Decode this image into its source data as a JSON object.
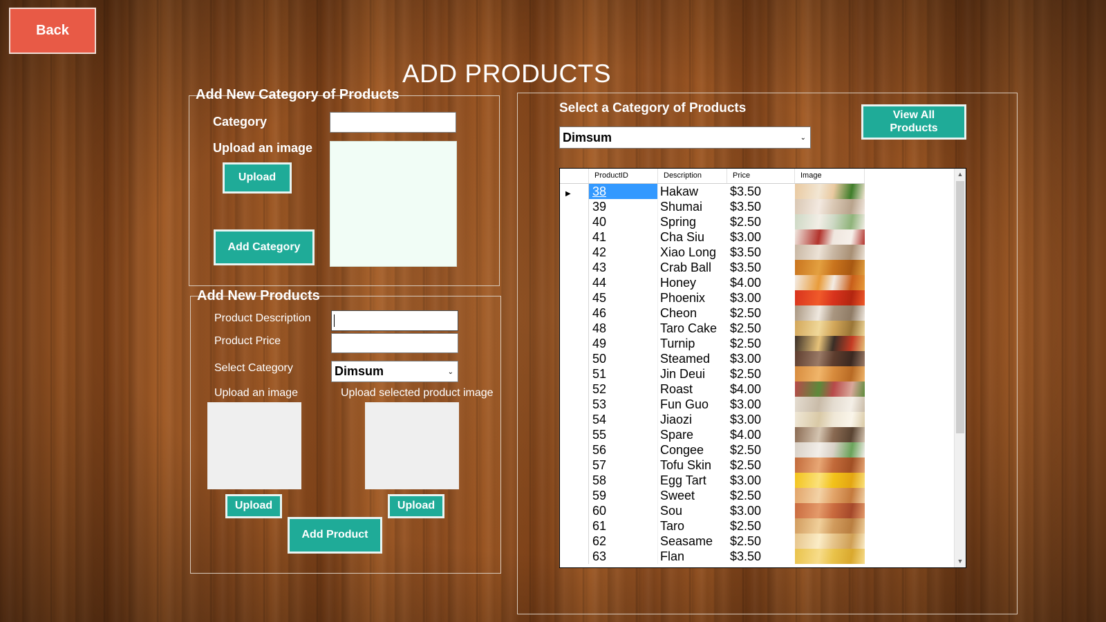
{
  "back_button": "Back",
  "page_title": "ADD PRODUCTS",
  "category_group": {
    "title": "Add New Category of Products",
    "category_label": "Category",
    "category_value": "",
    "upload_image_label": "Upload an image",
    "upload_button": "Upload",
    "add_category_button": "Add Category"
  },
  "products_group": {
    "title": "Add New Products",
    "description_label": "Product Description",
    "description_value": "",
    "price_label": "Product Price",
    "price_value": "",
    "select_category_label": "Select Category",
    "select_category_value": "Dimsum",
    "upload_image_label": "Upload an image",
    "upload_selected_label": "Upload selected product image",
    "upload_button_1": "Upload",
    "upload_button_2": "Upload",
    "add_product_button": "Add Product"
  },
  "browse_group": {
    "title": "Select a Category of Products",
    "category_value": "Dimsum",
    "view_all_button": "View All Products"
  },
  "grid": {
    "columns": [
      "ProductID",
      "Description",
      "Price",
      "Image"
    ],
    "selected_row": 0,
    "rows": [
      {
        "id": "38",
        "desc": "Hakaw",
        "price": "$3.50",
        "thumb": [
          "#e9c9a0",
          "#f2e6d3",
          "#3f7d2a"
        ]
      },
      {
        "id": "39",
        "desc": "Shumai",
        "price": "$3.50",
        "thumb": [
          "#d9c7b3",
          "#f3e9e0",
          "#b8a38c"
        ]
      },
      {
        "id": "40",
        "desc": "Spring",
        "price": "$2.50",
        "thumb": [
          "#cdd8c4",
          "#f2eee6",
          "#8fb37a"
        ]
      },
      {
        "id": "41",
        "desc": "Cha Siu",
        "price": "$3.00",
        "thumb": [
          "#efe6de",
          "#b2332c",
          "#f6f0ea"
        ]
      },
      {
        "id": "42",
        "desc": "Xiao Long",
        "price": "$3.50",
        "thumb": [
          "#c8b6a2",
          "#ece2d6",
          "#a88f74"
        ]
      },
      {
        "id": "43",
        "desc": "Crab Ball",
        "price": "$3.50",
        "thumb": [
          "#c9741e",
          "#e3a040",
          "#a85812"
        ]
      },
      {
        "id": "44",
        "desc": "Honey",
        "price": "$4.00",
        "thumb": [
          "#f3ebe3",
          "#e89b3a",
          "#c85e1a"
        ]
      },
      {
        "id": "45",
        "desc": "Phoenix",
        "price": "$3.00",
        "thumb": [
          "#d8331d",
          "#f05a2a",
          "#b32610"
        ]
      },
      {
        "id": "46",
        "desc": "Cheon",
        "price": "$2.50",
        "thumb": [
          "#a99680",
          "#efe8df",
          "#8f7b65"
        ]
      },
      {
        "id": "48",
        "desc": "Taro Cake",
        "price": "$2.50",
        "thumb": [
          "#d2a659",
          "#f0d89a",
          "#9a7536"
        ]
      },
      {
        "id": "49",
        "desc": "Turnip",
        "price": "$2.50",
        "thumb": [
          "#3a2e26",
          "#e6c27a",
          "#c43b23"
        ]
      },
      {
        "id": "50",
        "desc": "Steamed",
        "price": "$3.00",
        "thumb": [
          "#5e3d2e",
          "#9a7a66",
          "#3b2820"
        ]
      },
      {
        "id": "51",
        "desc": "Jin Deui",
        "price": "$2.50",
        "thumb": [
          "#d78b3d",
          "#f0b56a",
          "#b86a24"
        ]
      },
      {
        "id": "52",
        "desc": "Roast",
        "price": "$4.00",
        "thumb": [
          "#b84a4a",
          "#5c8a3a",
          "#d9a79a"
        ]
      },
      {
        "id": "53",
        "desc": "Fun Guo",
        "price": "$3.00",
        "thumb": [
          "#e4dcd0",
          "#c9bba8",
          "#f4efe7"
        ]
      },
      {
        "id": "54",
        "desc": "Jiaozi",
        "price": "$3.00",
        "thumb": [
          "#efe7d6",
          "#d9c9a6",
          "#faf5ea"
        ]
      },
      {
        "id": "55",
        "desc": "Spare",
        "price": "$4.00",
        "thumb": [
          "#8a6a52",
          "#d4c4b0",
          "#5a4432"
        ]
      },
      {
        "id": "56",
        "desc": "Congee",
        "price": "$2.50",
        "thumb": [
          "#d8d0c6",
          "#f2eee9",
          "#6aa35a"
        ]
      },
      {
        "id": "57",
        "desc": "Tofu Skin",
        "price": "$2.50",
        "thumb": [
          "#c26a3a",
          "#e8a775",
          "#a14f24"
        ]
      },
      {
        "id": "58",
        "desc": "Egg Tart",
        "price": "$3.00",
        "thumb": [
          "#f2c21a",
          "#fbe17a",
          "#e3a612"
        ]
      },
      {
        "id": "59",
        "desc": "Sweet",
        "price": "$2.50",
        "thumb": [
          "#e2a469",
          "#f3d2a6",
          "#c47a3d"
        ]
      },
      {
        "id": "60",
        "desc": "Sou",
        "price": "$3.00",
        "thumb": [
          "#c96a3e",
          "#e49a6a",
          "#a5482a"
        ]
      },
      {
        "id": "61",
        "desc": "Taro",
        "price": "$2.50",
        "thumb": [
          "#d19b5d",
          "#f0cf9a",
          "#b97e40"
        ]
      },
      {
        "id": "62",
        "desc": "Seasame",
        "price": "$2.50",
        "thumb": [
          "#e6c48a",
          "#fbecc6",
          "#cf9f55"
        ]
      },
      {
        "id": "63",
        "desc": "Flan",
        "price": "$3.50",
        "thumb": [
          "#e9c24a",
          "#f7dc8a",
          "#d9a82e"
        ]
      }
    ]
  },
  "colors": {
    "back_button": "#e85a46",
    "teal_button": "#1fab98",
    "selection": "#3399ff",
    "image_preview": "#f1fdf6",
    "image_placeholder": "#efefef"
  }
}
